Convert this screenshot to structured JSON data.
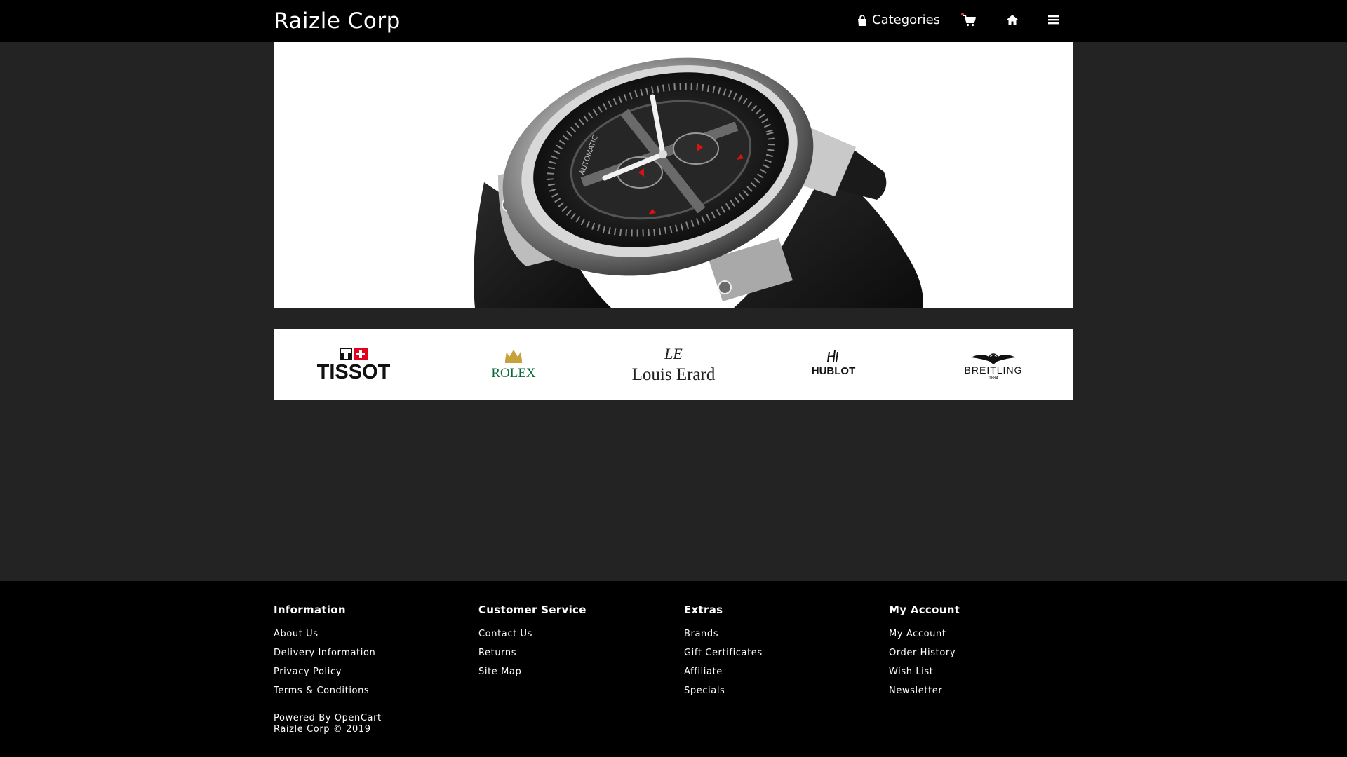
{
  "header": {
    "brand": "Raizle Corp",
    "categories_label": "Categories",
    "icons": [
      "shopping-bag-icon",
      "cart-icon",
      "home-icon",
      "menu-icon"
    ]
  },
  "hero": {
    "image": "wristwatch-banner",
    "dial_text": "AUTOMATIC"
  },
  "brands": [
    {
      "name": "TISSOT",
      "logo_text": "TISSOT",
      "badge": "T+"
    },
    {
      "name": "ROLEX",
      "logo_text": "ROLEX"
    },
    {
      "name": "Louis Erard",
      "logo_text": "Louis Erard",
      "monogram": "LE"
    },
    {
      "name": "HUBLOT",
      "logo_text": "HUBLOT"
    },
    {
      "name": "BREITLING",
      "logo_text": "BREITLING",
      "sub": "1884"
    }
  ],
  "footer": {
    "columns": [
      {
        "title": "Information",
        "links": [
          "About Us",
          "Delivery Information",
          "Privacy Policy",
          "Terms & Conditions"
        ]
      },
      {
        "title": "Customer Service",
        "links": [
          "Contact Us",
          "Returns",
          "Site Map"
        ]
      },
      {
        "title": "Extras",
        "links": [
          "Brands",
          "Gift Certificates",
          "Affiliate",
          "Specials"
        ]
      },
      {
        "title": "My Account",
        "links": [
          "My Account",
          "Order History",
          "Wish List",
          "Newsletter"
        ]
      }
    ],
    "powered_prefix": "Powered By",
    "powered_link": "OpenCart",
    "copyright": "Raizle Corp © 2019"
  },
  "colors": {
    "page_bg": "#232323",
    "bar_bg": "#000000",
    "rolex_green": "#0a6b3a",
    "cart_dot": "#e0343a",
    "tissot_red": "#e2001a"
  }
}
